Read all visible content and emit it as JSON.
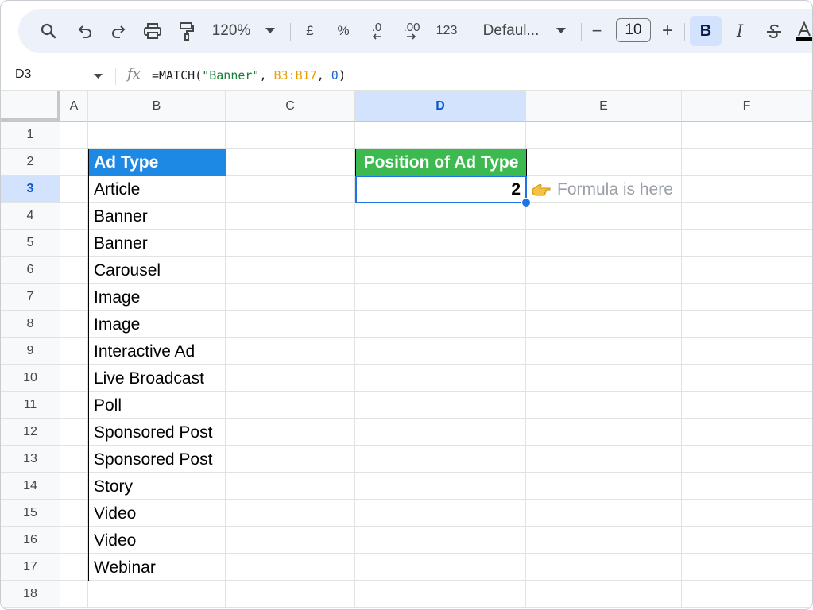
{
  "toolbar": {
    "zoom": "120%",
    "currency": "£",
    "percent": "%",
    "decrease_decimal": ".0",
    "increase_decimal": ".00",
    "number_format": "123",
    "font": "Defaul...",
    "minus": "−",
    "font_size": "10",
    "plus": "+",
    "bold": "B",
    "italic": "I"
  },
  "formula_bar": {
    "cell_ref": "D3",
    "fx": "fx",
    "formula_prefix": "=MATCH(",
    "formula_string": "\"Banner\"",
    "formula_sep1": ", ",
    "formula_range": "B3:B17",
    "formula_sep2": ", ",
    "formula_number": "0",
    "formula_suffix": ")"
  },
  "columns": [
    "A",
    "B",
    "C",
    "D",
    "E",
    "F"
  ],
  "selected_column": "D",
  "rows": [
    "1",
    "2",
    "3",
    "4",
    "5",
    "6",
    "7",
    "8",
    "9",
    "10",
    "11",
    "12",
    "13",
    "14",
    "15",
    "16",
    "17",
    "18"
  ],
  "selected_row": "3",
  "table": {
    "header": "Ad Type",
    "items": [
      "Article",
      "Banner",
      "Banner",
      "Carousel",
      "Image",
      "Image",
      "Interactive Ad",
      "Live Broadcast",
      "Poll",
      "Sponsored Post",
      "Sponsored Post",
      "Story",
      "Video",
      "Video",
      "Webinar"
    ]
  },
  "result": {
    "header": "Position of Ad Type",
    "value": "2",
    "note": "Formula is here"
  },
  "colors": {
    "blue_header": "#1e88e5",
    "green_header": "#3cba4f",
    "selection": "#1a73e8"
  }
}
